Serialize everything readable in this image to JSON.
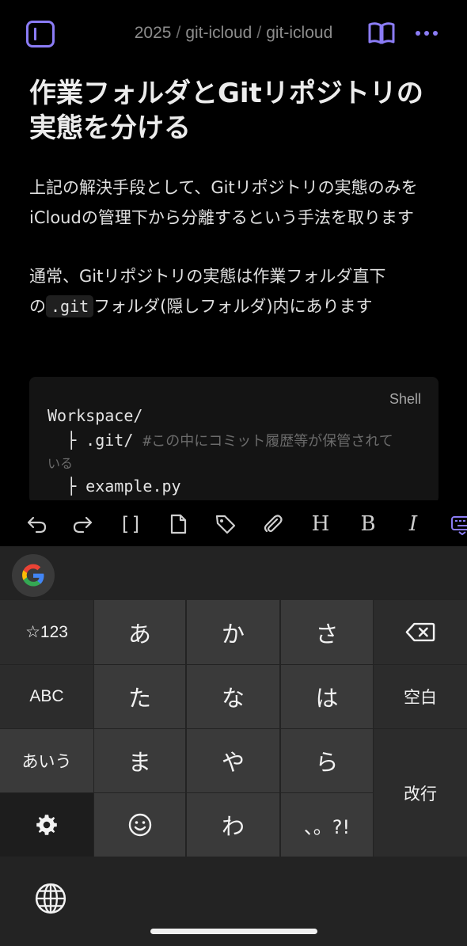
{
  "header": {
    "breadcrumb": [
      "2025",
      "git-icloud",
      "git-icloud"
    ],
    "separator": "/"
  },
  "document": {
    "title": "作業フォルダとGitリポジトリの実態を分ける",
    "paragraph1": "上記の解決手段として、Gitリポジトリの実態のみをiCloudの管理下から分離するという手法を取ります",
    "paragraph2_before": "通常、Gitリポジトリの実態は作業フォルダ直下の",
    "paragraph2_code": ".git",
    "paragraph2_after": "フォルダ(隠しフォルダ)内にあります",
    "code_block": {
      "language": "Shell",
      "line1": "Workspace/",
      "line2_prefix": "  ├ .git/ ",
      "line2_comment": "#この中にコミット履歴等が保管されて",
      "line2_wrap": "いる",
      "line3": "  ├ example.py"
    }
  },
  "toolbar": {
    "items": [
      "undo-icon",
      "redo-icon",
      "brackets-icon",
      "file-icon",
      "tag-icon",
      "attachment-icon",
      "heading-icon",
      "bold-icon",
      "italic-icon",
      "keyboard-icon"
    ],
    "heading_label": "H",
    "bold_label": "B",
    "italic_label": "I",
    "brackets_label": "[]"
  },
  "keyboard": {
    "left_keys": [
      "☆123",
      "ABC",
      "あいう"
    ],
    "main_keys": [
      [
        "あ",
        "か",
        "さ"
      ],
      [
        "た",
        "な",
        "は"
      ],
      [
        "ま",
        "や",
        "ら"
      ],
      [
        "☺",
        "わ",
        "、。?!"
      ]
    ],
    "space_label": "空白",
    "enter_label": "改行"
  },
  "colors": {
    "accent": "#8b7cf6",
    "background": "#000000",
    "keyboard_bg": "#232323"
  }
}
